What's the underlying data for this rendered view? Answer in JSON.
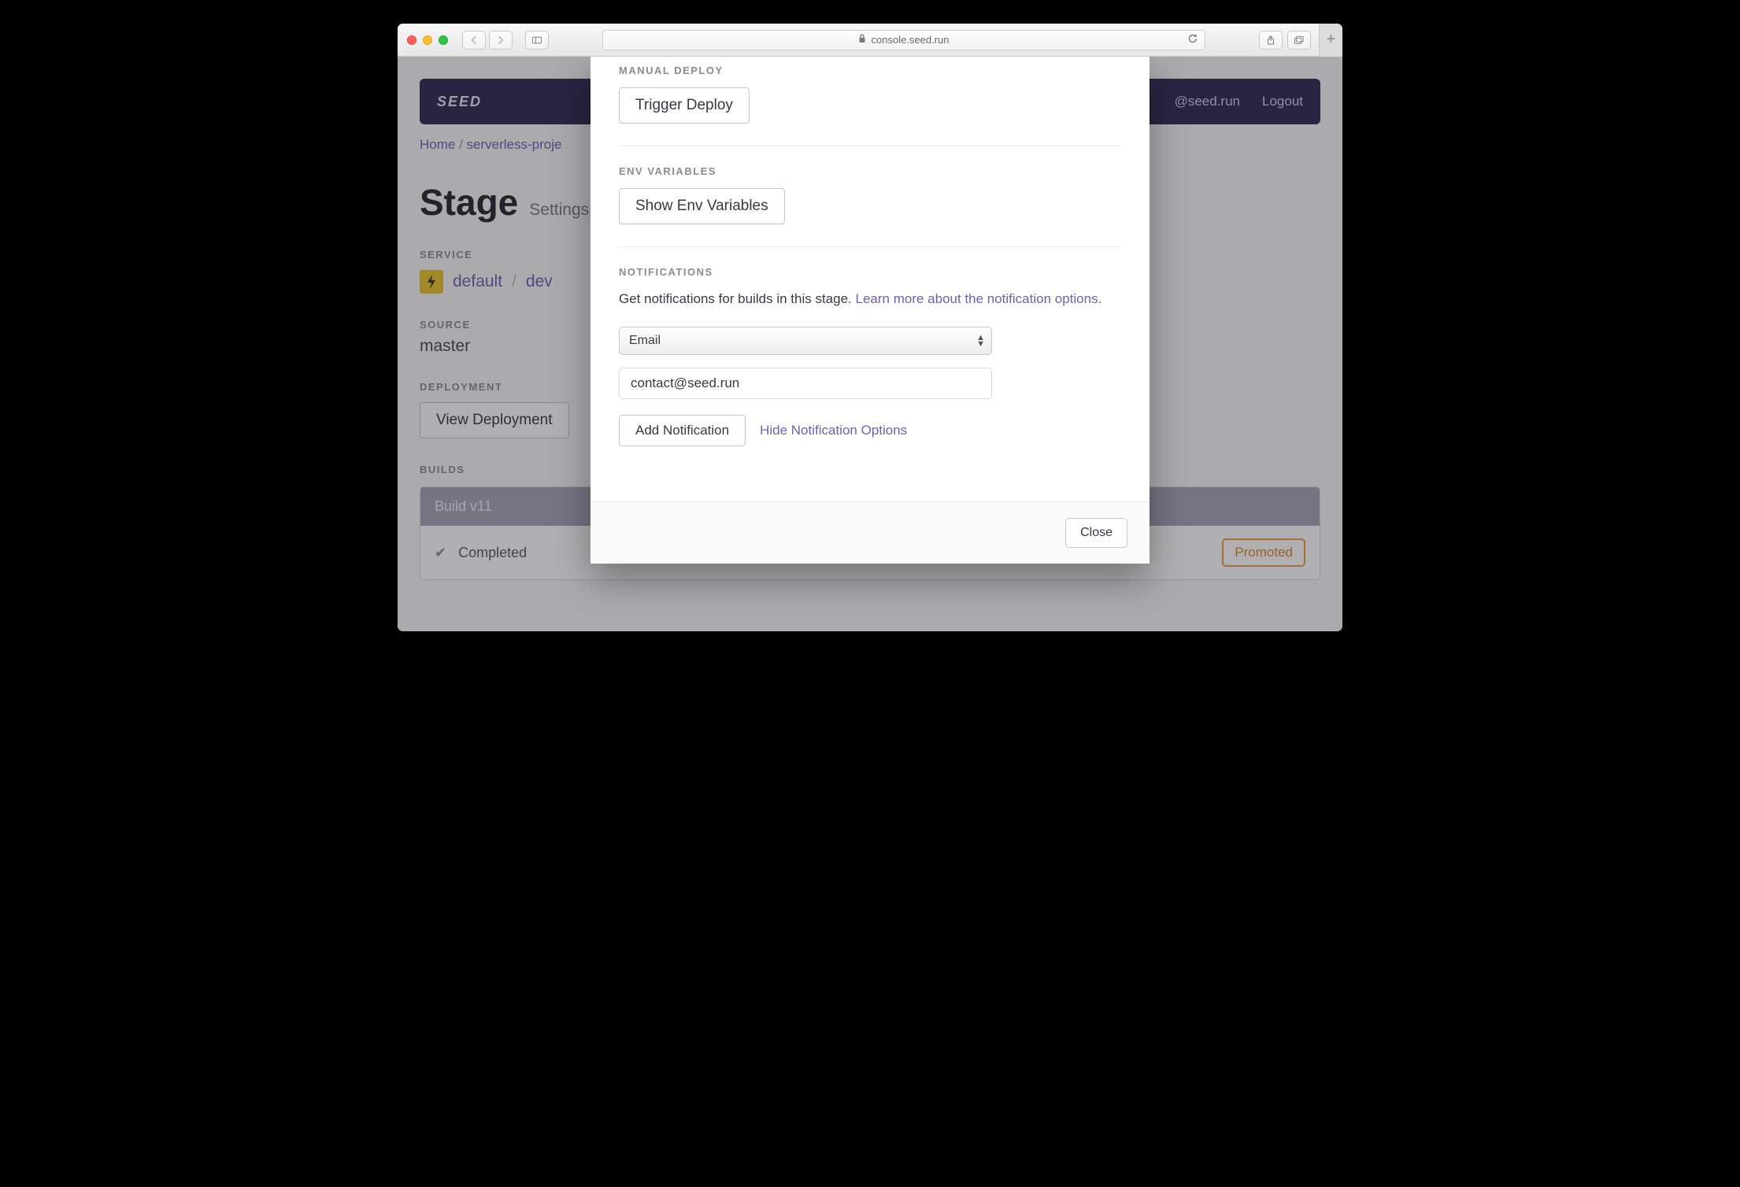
{
  "browser": {
    "url_host": "console.seed.run"
  },
  "navbar": {
    "logo": "SEED",
    "user_label": "@seed.run",
    "logout_label": "Logout"
  },
  "breadcrumbs": {
    "home": "Home",
    "project": "serverless-proje"
  },
  "page": {
    "title": "Stage",
    "subtitle": "Settings"
  },
  "service_section": {
    "label": "SERVICE",
    "service_name": "default",
    "stage_name": "dev"
  },
  "source_section": {
    "label": "SOURCE",
    "value": "master"
  },
  "deployment_section": {
    "label": "DEPLOYMENT",
    "button_label": "View Deployment"
  },
  "builds_section": {
    "label": "BUILDS",
    "row": {
      "title": "Build v11",
      "status": "Completed",
      "badge": "Promoted"
    }
  },
  "modal": {
    "manual_deploy": {
      "label": "MANUAL DEPLOY",
      "button": "Trigger Deploy"
    },
    "env": {
      "label": "ENV VARIABLES",
      "button": "Show Env Variables"
    },
    "notifications": {
      "label": "NOTIFICATIONS",
      "intro": "Get notifications for builds in this stage. ",
      "learn_more": "Learn more about the notification options.",
      "select_value": "Email",
      "input_value": "contact@seed.run",
      "add_button": "Add Notification",
      "hide_link": "Hide Notification Options"
    },
    "close": "Close"
  }
}
